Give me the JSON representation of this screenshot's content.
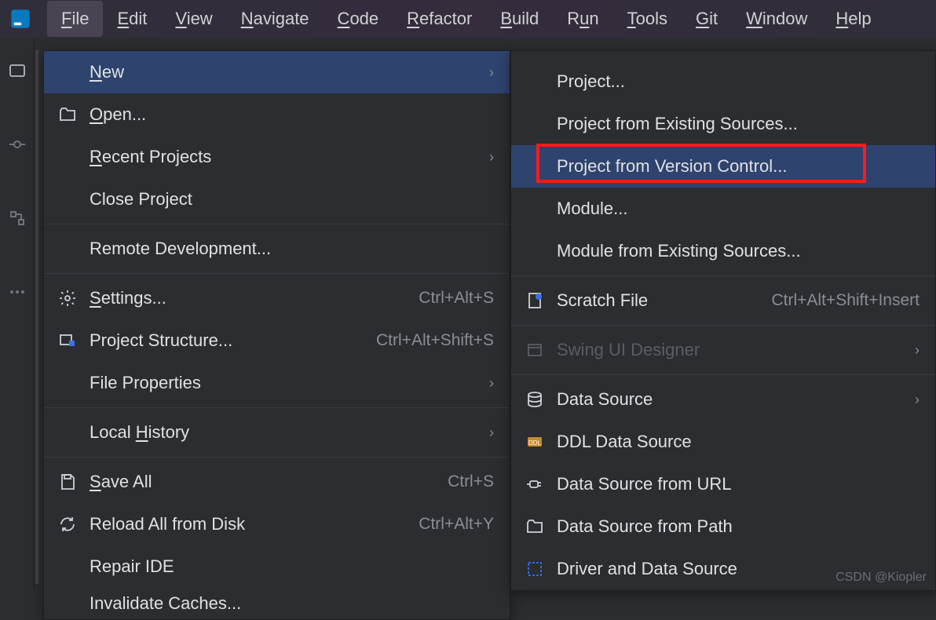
{
  "menubar": {
    "items": [
      {
        "label": "File",
        "mn": "F",
        "active": true
      },
      {
        "label": "Edit",
        "mn": "E"
      },
      {
        "label": "View",
        "mn": "V"
      },
      {
        "label": "Navigate",
        "mn": "N"
      },
      {
        "label": "Code",
        "mn": "C"
      },
      {
        "label": "Refactor",
        "mn": "R"
      },
      {
        "label": "Build",
        "mn": "B"
      },
      {
        "label": "Run",
        "mn": "u"
      },
      {
        "label": "Tools",
        "mn": "T"
      },
      {
        "label": "Git",
        "mn": "G"
      },
      {
        "label": "Window",
        "mn": "W"
      },
      {
        "label": "Help",
        "mn": "H"
      }
    ]
  },
  "file_menu": {
    "new": {
      "label": "New",
      "mn": "N"
    },
    "open": {
      "label": "Open...",
      "mn": "O"
    },
    "recent": {
      "label": "Recent Projects",
      "mn": "R"
    },
    "close": {
      "label": "Close Project"
    },
    "remote": {
      "label": "Remote Development..."
    },
    "settings": {
      "label": "Settings...",
      "mn": "S",
      "shortcut": "Ctrl+Alt+S"
    },
    "structure": {
      "label": "Project Structure...",
      "shortcut": "Ctrl+Alt+Shift+S"
    },
    "fileprops": {
      "label": "File Properties"
    },
    "localhist": {
      "label": "Local History",
      "mn": "H"
    },
    "saveall": {
      "label": "Save All",
      "mn": "S",
      "shortcut": "Ctrl+S"
    },
    "reload": {
      "label": "Reload All from Disk",
      "shortcut": "Ctrl+Alt+Y"
    },
    "repair": {
      "label": "Repair IDE"
    },
    "invalidate": {
      "label": "Invalidate Caches..."
    }
  },
  "new_menu": {
    "project": {
      "label": "Project..."
    },
    "project_existing": {
      "label": "Project from Existing Sources..."
    },
    "project_vcs": {
      "label": "Project from Version Control..."
    },
    "module": {
      "label": "Module..."
    },
    "module_existing": {
      "label": "Module from Existing Sources..."
    },
    "scratch": {
      "label": "Scratch File",
      "shortcut": "Ctrl+Alt+Shift+Insert"
    },
    "swing": {
      "label": "Swing UI Designer"
    },
    "datasource": {
      "label": "Data Source"
    },
    "ddl": {
      "label": "DDL Data Source"
    },
    "ds_url": {
      "label": "Data Source from URL"
    },
    "ds_path": {
      "label": "Data Source from Path"
    },
    "driver": {
      "label": "Driver and Data Source"
    }
  },
  "watermark": "CSDN @Kiopler"
}
